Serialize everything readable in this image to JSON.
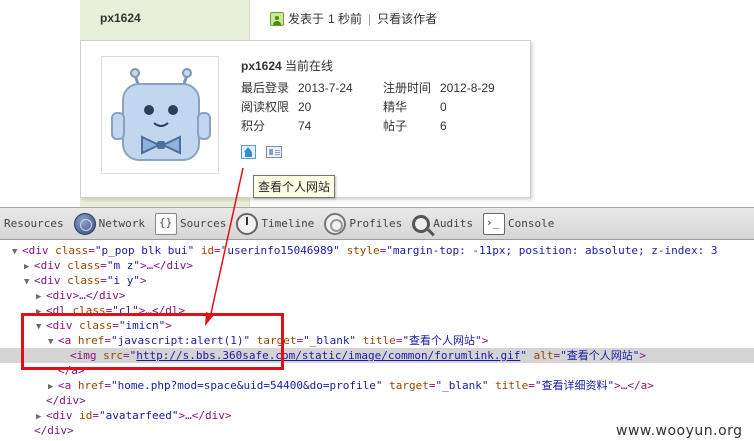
{
  "post": {
    "author": "px1624",
    "posted_prefix": "发表于",
    "posted_time": "1 秒前",
    "separator": "|",
    "author_only_link": "只看该作者"
  },
  "popup": {
    "username": "px1624",
    "status": "当前在线",
    "stats": [
      [
        "最后登录",
        "2013-7-24",
        "注册时间",
        "2012-8-29"
      ],
      [
        "阅读权限",
        "20",
        "精华",
        "0"
      ],
      [
        "积分",
        "74",
        "帖子",
        "6"
      ]
    ],
    "icons": [
      "home-icon",
      "profile-card-icon"
    ]
  },
  "tooltip": "查看个人网站",
  "devtools": {
    "tabs": [
      {
        "label": "Resources",
        "icon": ""
      },
      {
        "label": "Network",
        "icon": "network-icon"
      },
      {
        "label": "Sources",
        "icon": "sources-icon"
      },
      {
        "label": "Timeline",
        "icon": "timeline-icon"
      },
      {
        "label": "Profiles",
        "icon": "profiles-icon"
      },
      {
        "label": "Audits",
        "icon": "audits-icon"
      },
      {
        "label": "Console",
        "icon": "console-icon"
      }
    ],
    "dom": {
      "l0": {
        "tag_open": "<div ",
        "a1": "class",
        "v1": "\"p_pop blk bui\"",
        "a2": "id",
        "v2": "\"userinfo15046989\"",
        "a3": "style",
        "v3": "\"margin-top: -11px; position: absolute; z-index: 3"
      },
      "l1": {
        "tag_open": "<div ",
        "a1": "class",
        "v1": "\"m z\"",
        "rest": ">…</div>"
      },
      "l2": {
        "tag_open": "<div ",
        "a1": "class",
        "v1": "\"i y\"",
        "rest": ">"
      },
      "l3": {
        "text": "<div>…</div>"
      },
      "l4": {
        "tag_open": "<dl ",
        "a1": "class",
        "v1": "\"cl\"",
        "rest": ">…</dl>"
      },
      "l5": {
        "tag_open": "<div ",
        "a1": "class",
        "v1": "\"imicn\"",
        "rest": ">"
      },
      "l6": {
        "tag_open": "<a ",
        "a1": "href",
        "v1": "\"javascript:alert(1)\"",
        "a2": "target",
        "v2": "\"_blank\"",
        "a3": "title",
        "v3": "\"查看个人网站\"",
        "rest": ">"
      },
      "l7": {
        "tag_open": "<img ",
        "a1": "src",
        "q": "\"",
        "url": "http://s.bbs.360safe.com/static/image/common/forumlink.gif",
        "a2": "alt",
        "v2": "\"查看个人网站\"",
        "rest": ">"
      },
      "l8": {
        "text": "</a>"
      },
      "l9": {
        "tag_open": "<a ",
        "a1": "href",
        "v1": "\"home.php?mod=space&uid=54400&do=profile\"",
        "a2": "target",
        "v2": "\"_blank\"",
        "a3": "title",
        "v3": "\"查看详细资料\"",
        "rest": ">…</a>"
      },
      "l10": {
        "text": "</div>"
      },
      "l11": {
        "tag_open": "<div ",
        "a1": "id",
        "v1": "\"avatarfeed\"",
        "rest": ">…</div>"
      },
      "l12": {
        "text": "</div>"
      }
    }
  },
  "watermark": "www.wooyun.org",
  "colors": {
    "highlight_box": "#e0101a",
    "arrow": "#e0101a",
    "left_column": "#e8efd8"
  }
}
